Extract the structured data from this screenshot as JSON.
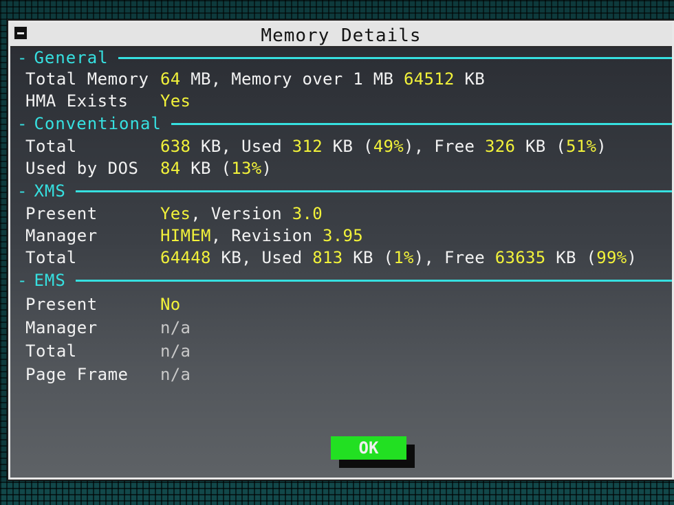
{
  "window": {
    "title": "Memory Details"
  },
  "sections": {
    "general": {
      "name": "General",
      "total_memory": {
        "label": "Total Memory",
        "total_value": "64",
        "total_unit": " MB, Memory over 1 MB ",
        "over_value": "64512",
        "over_unit": " KB"
      },
      "hma_exists": {
        "label": "HMA Exists",
        "value": "Yes"
      }
    },
    "conventional": {
      "name": "Conventional",
      "total": {
        "label": "Total",
        "total_kb": "638",
        "t1": " KB, Used ",
        "used_kb": "312",
        "t2": " KB (",
        "used_pct": "49%",
        "t3": "), Free ",
        "free_kb": "326",
        "t4": " KB (",
        "free_pct": "51%",
        "t5": ")"
      },
      "used_by_dos": {
        "label": "Used by DOS",
        "kb": "84",
        "t1": " KB (",
        "pct": "13%",
        "t2": ")"
      }
    },
    "xms": {
      "name": "XMS",
      "present": {
        "label": "Present",
        "value": "Yes",
        "t1": ", Version ",
        "version": "3.0"
      },
      "manager": {
        "label": "Manager",
        "value": "HIMEM",
        "t1": ", Revision ",
        "revision": "3.95"
      },
      "total": {
        "label": "Total",
        "total_kb": "64448",
        "t1": " KB, Used ",
        "used_kb": "813",
        "t2": " KB (",
        "used_pct": "1%",
        "t3": "), Free ",
        "free_kb": "63635",
        "t4": " KB (",
        "free_pct": "99%",
        "t5": ")"
      }
    },
    "ems": {
      "name": "EMS",
      "present": {
        "label": "Present",
        "value": "No"
      },
      "manager": {
        "label": "Manager",
        "value": "n/a"
      },
      "total": {
        "label": "Total",
        "value": "n/a"
      },
      "page_frame": {
        "label": "Page Frame",
        "value": "n/a"
      }
    }
  },
  "buttons": {
    "ok_label": "OK"
  },
  "colors": {
    "accent_cyan": "#36e0e0",
    "value_yellow": "#f2f23a",
    "button_green": "#22e022",
    "label_white": "#f2f2f2"
  }
}
